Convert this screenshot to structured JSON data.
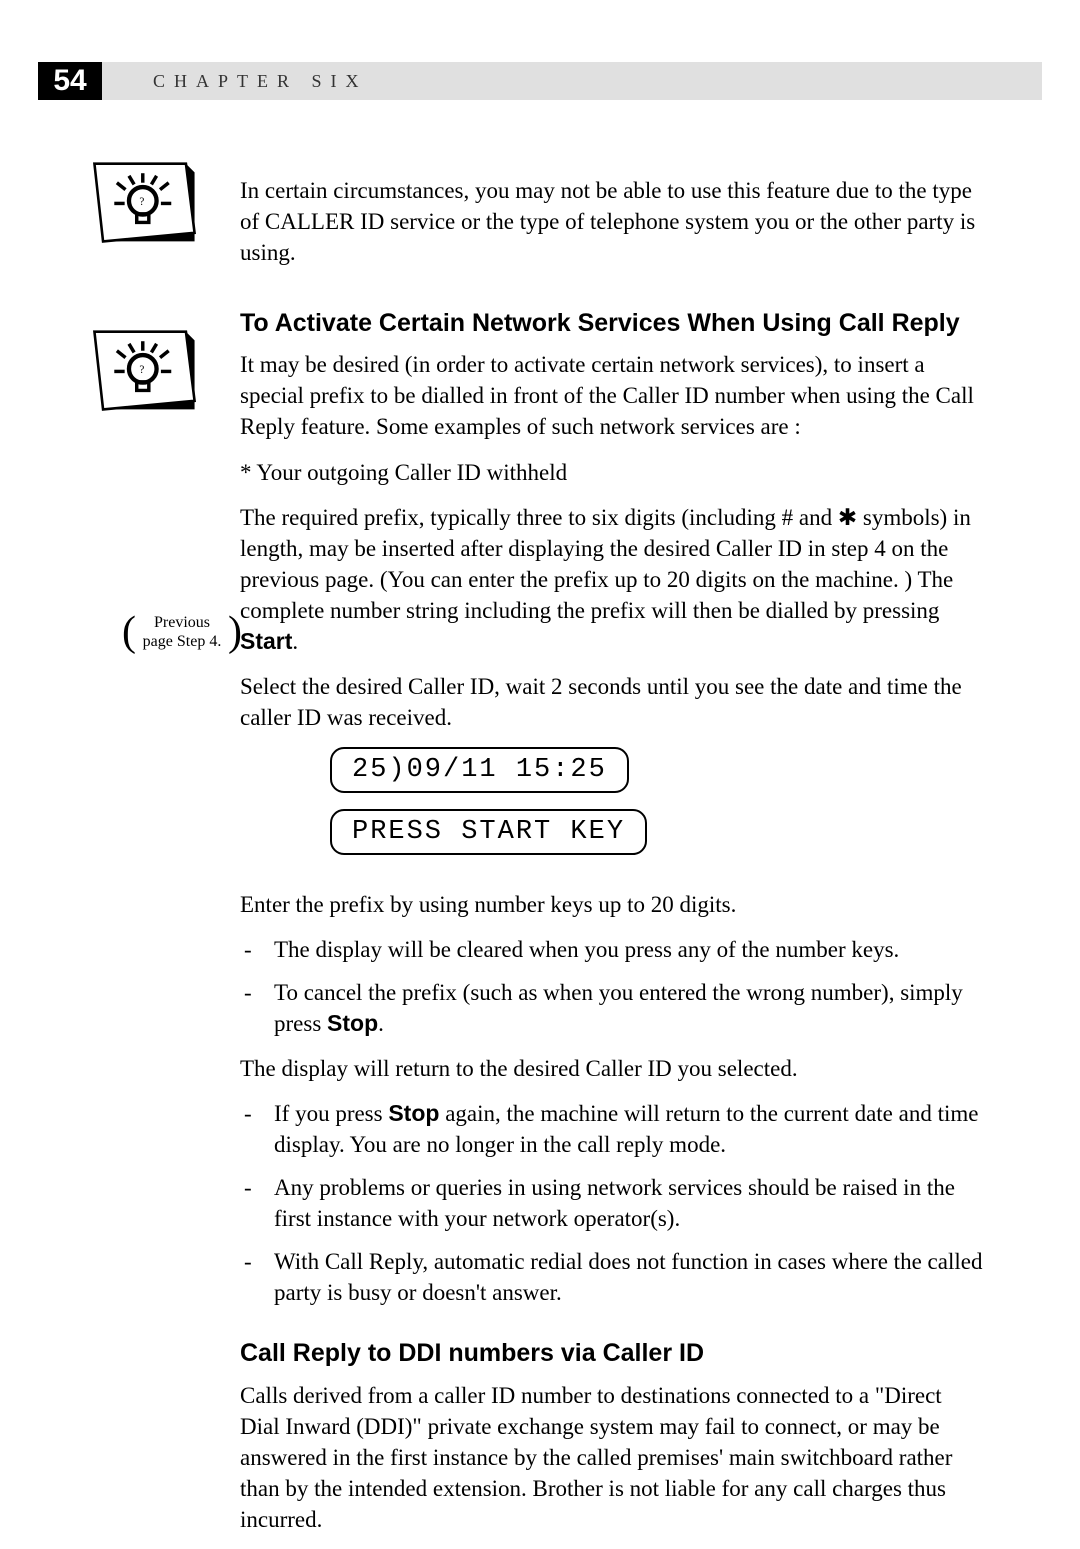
{
  "page_number": "54",
  "chapter_label": "CHAPTER SIX",
  "intro_note": "In certain circumstances, you may not be able to use this feature due to the type of CALLER ID service or the type of telephone system you or the other party is using.",
  "section1": {
    "heading": "To Activate Certain Network Services When Using Call Reply",
    "p1": "It may be desired (in order to activate certain network services), to insert a special prefix to  be dialled in front of the Caller ID number when using the Call Reply feature. Some examples of such network services are :",
    "p2": "* Your outgoing Caller ID withheld",
    "p3_a": "The required prefix, typically three to six digits (including # and ✱ symbols) in length, may be inserted after displaying the desired Caller ID in step 4 on the previous page. (You can enter the prefix up to 20 digits on the machine. ) The complete number string including the prefix will then be dialled by pressing ",
    "p3_b": "Start",
    "p3_c": ".",
    "step_ref_line1": "Previous",
    "step_ref_line2": "page Step 4.",
    "p4": "Select the desired Caller ID, wait 2 seconds until you see the date and time the caller ID was received.",
    "lcd1": "25)09/11 15:25",
    "lcd2": "PRESS START KEY",
    "p5": "Enter the prefix by using number keys up to 20 digits.",
    "bullets1_li1": "The display will be cleared when you press any of the number keys.",
    "bullets1_li2_a": "To cancel the prefix (such as when you entered the wrong number), simply press ",
    "bullets1_li2_b": "Stop",
    "bullets1_li2_c": ".",
    "p6": "The display will return to the desired Caller ID you selected.",
    "bullets2_li1_a": "If you press ",
    "bullets2_li1_b": "Stop",
    "bullets2_li1_c": " again, the machine will return to the current date and time display. You are no longer in the call reply mode.",
    "bullets2_li2": "Any problems or queries in using network services should be raised in the first instance with your network operator(s).",
    "bullets2_li3": "With Call Reply, automatic redial does not function in cases where the called party is busy or doesn't answer."
  },
  "section2": {
    "heading": "Call Reply to DDI numbers via Caller ID",
    "p1": "Calls derived from a caller ID number to destinations connected to a \"Direct Dial Inward (DDI)\" private exchange system may fail to connect, or may be answered in the first instance by the called premises' main switchboard rather than by the intended extension. Brother is not liable for any call charges thus incurred."
  }
}
